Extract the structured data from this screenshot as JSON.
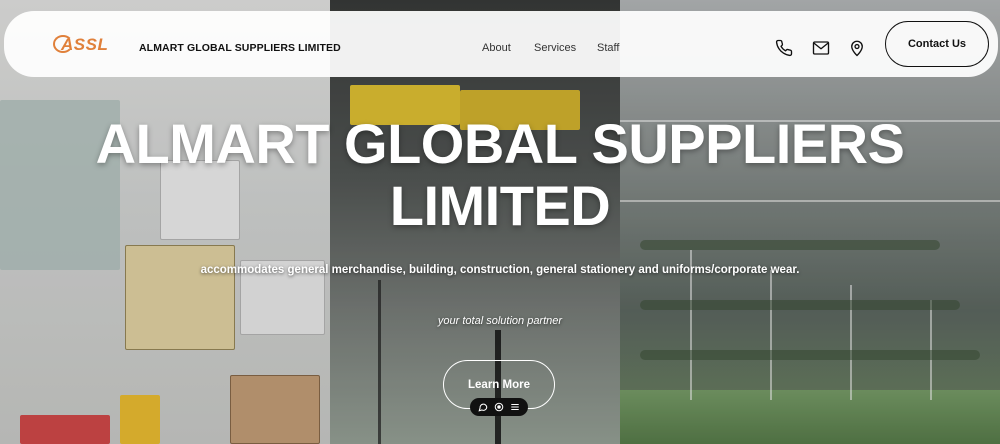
{
  "header": {
    "logo_text": "ASSL",
    "brand": "ALMART GLOBAL SUPPLIERS LIMITED",
    "nav": [
      {
        "label": "About"
      },
      {
        "label": "Services"
      },
      {
        "label": "Staff"
      }
    ],
    "icons": [
      "phone-icon",
      "mail-icon",
      "location-icon"
    ],
    "contact_label": "Contact Us"
  },
  "hero": {
    "title_line1": "ALMART GLOBAL SUPPLIERS",
    "title_line2": "LIMITED",
    "subtitle": "accommodates general merchandise, building, construction, general stationery and uniforms/corporate wear.",
    "tagline": "your total solution partner",
    "cta_label": "Learn More"
  },
  "dock": {
    "icons": [
      "chat-icon",
      "eye-icon",
      "menu-icon"
    ]
  },
  "colors": {
    "accent": "#e0803a",
    "header_bg": "#ffffff",
    "text_dark": "#111111",
    "hero_text": "#ffffff"
  }
}
